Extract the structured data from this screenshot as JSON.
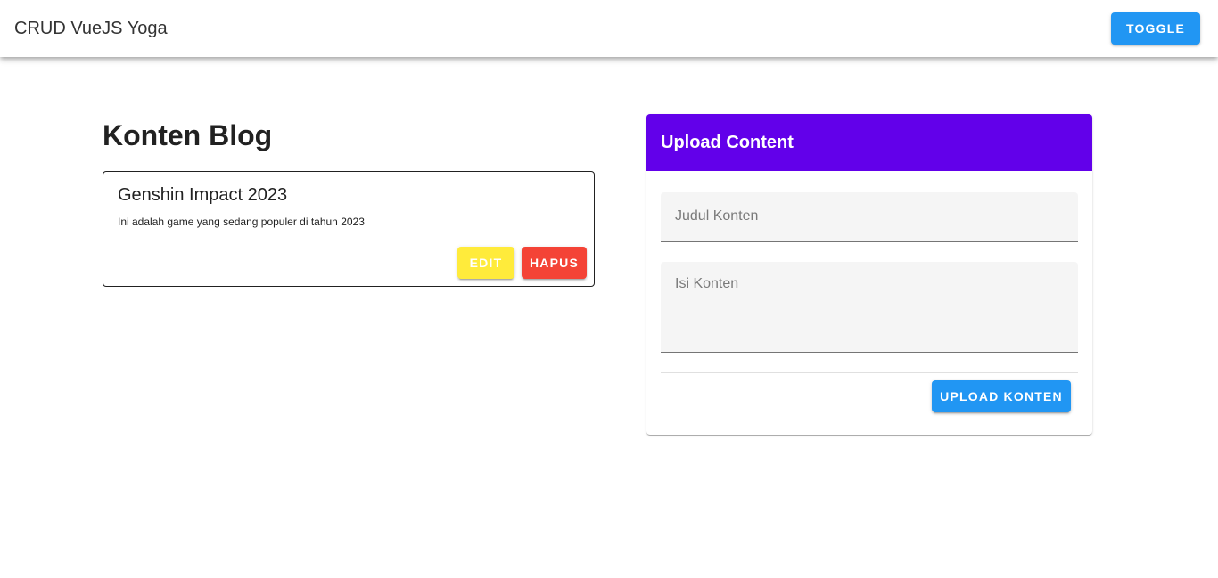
{
  "app_bar": {
    "title": "CRUD VueJS Yoga",
    "toggle_label": "TOGGLE"
  },
  "blog": {
    "heading": "Konten Blog",
    "posts": [
      {
        "title": "Genshin Impact 2023",
        "text": "Ini adalah game yang sedang populer di tahun 2023",
        "edit_label": "EDIT",
        "delete_label": "HAPUS"
      }
    ]
  },
  "upload": {
    "header": "Upload Content",
    "title_placeholder": "Judul Konten",
    "content_placeholder": "Isi Konten",
    "submit_label": "UPLOAD KONTEN"
  },
  "colors": {
    "primary": "#2196f3",
    "header_purple": "#6200ea",
    "edit_yellow": "#ffeb3b",
    "delete_red": "#f44336"
  }
}
